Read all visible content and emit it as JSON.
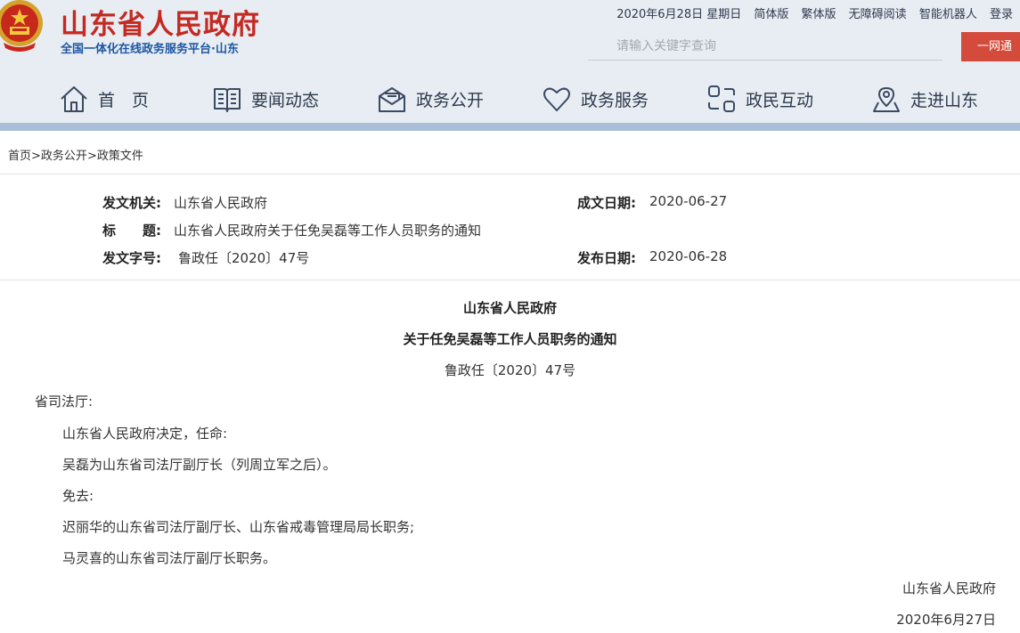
{
  "header": {
    "title": "山东省人民政府",
    "subtitle": "全国一体化在线政务服务平台·山东",
    "date": "2020年6月28日 星期日",
    "links": [
      "简体版",
      "繁体版",
      "无障碍阅读",
      "智能机器人",
      "登录"
    ],
    "search_placeholder": "请输入关键字查询",
    "portal_button": "一网通"
  },
  "nav": [
    {
      "label": "首　页",
      "icon": "home-icon"
    },
    {
      "label": "要闻动态",
      "icon": "book-icon"
    },
    {
      "label": "政务公开",
      "icon": "mail-icon"
    },
    {
      "label": "政务服务",
      "icon": "heart-icon"
    },
    {
      "label": "政民互动",
      "icon": "interaction-icon"
    },
    {
      "label": "走进山东",
      "icon": "location-icon"
    }
  ],
  "breadcrumb": [
    "首页",
    "政务公开",
    "政策文件"
  ],
  "meta": {
    "issuer_label": "发文机关:",
    "issuer": "山东省人民政府",
    "written_label": "成文日期:",
    "written_date": "2020-06-27",
    "title_label": "标　　题:",
    "title": "山东省人民政府关于任免吴磊等工作人员职务的通知",
    "docno_label": "发文字号:",
    "docno": "鲁政任〔2020〕47号",
    "publish_label": "发布日期:",
    "publish_date": "2020-06-28"
  },
  "document": {
    "org": "山东省人民政府",
    "title": "关于任免吴磊等工作人员职务的通知",
    "docno": "鲁政任〔2020〕47号",
    "recipient": "省司法厅:",
    "paragraphs": [
      "山东省人民政府决定，任命:",
      "吴磊为山东省司法厅副厅长（列周立军之后）。",
      "免去:",
      "迟丽华的山东省司法厅副厅长、山东省戒毒管理局局长职务;",
      "马灵喜的山东省司法厅副厅长职务。"
    ],
    "signature": "山东省人民政府",
    "date": "2020年6月27日"
  }
}
